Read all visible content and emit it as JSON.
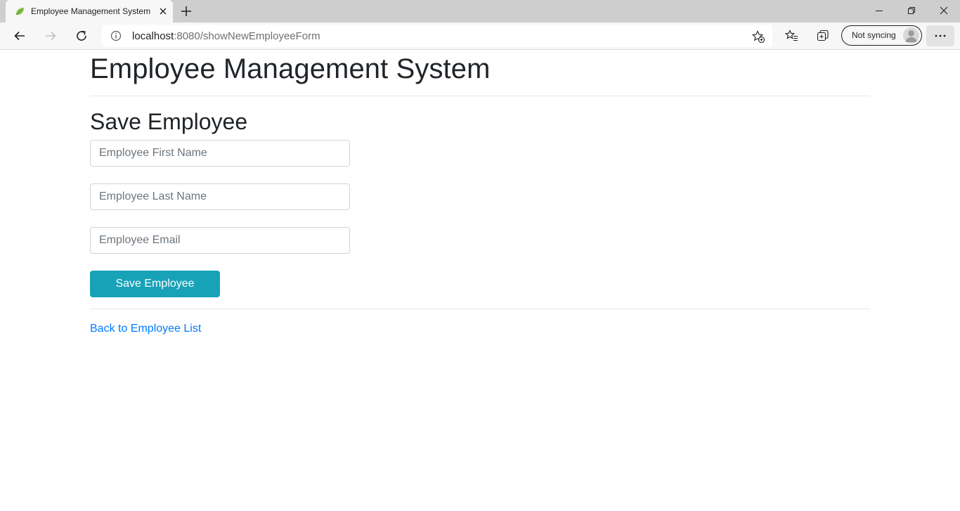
{
  "browser": {
    "tab": {
      "title": "Employee Management System",
      "favicon": "spring-leaf-icon"
    },
    "address_bar": {
      "url_host": "localhost",
      "url_rest": ":8080/showNewEmployeeForm"
    },
    "profile": {
      "label": "Not syncing"
    }
  },
  "page": {
    "title": "Employee Management System",
    "form_heading": "Save Employee",
    "fields": {
      "first_name": {
        "value": "",
        "placeholder": "Employee First Name"
      },
      "last_name": {
        "value": "",
        "placeholder": "Employee Last Name"
      },
      "email": {
        "value": "",
        "placeholder": "Employee Email"
      }
    },
    "submit_label": "Save Employee",
    "back_link": "Back to Employee List"
  },
  "colors": {
    "button": "#17a2b8",
    "link": "#007bff",
    "favicon": "#6db33f"
  }
}
